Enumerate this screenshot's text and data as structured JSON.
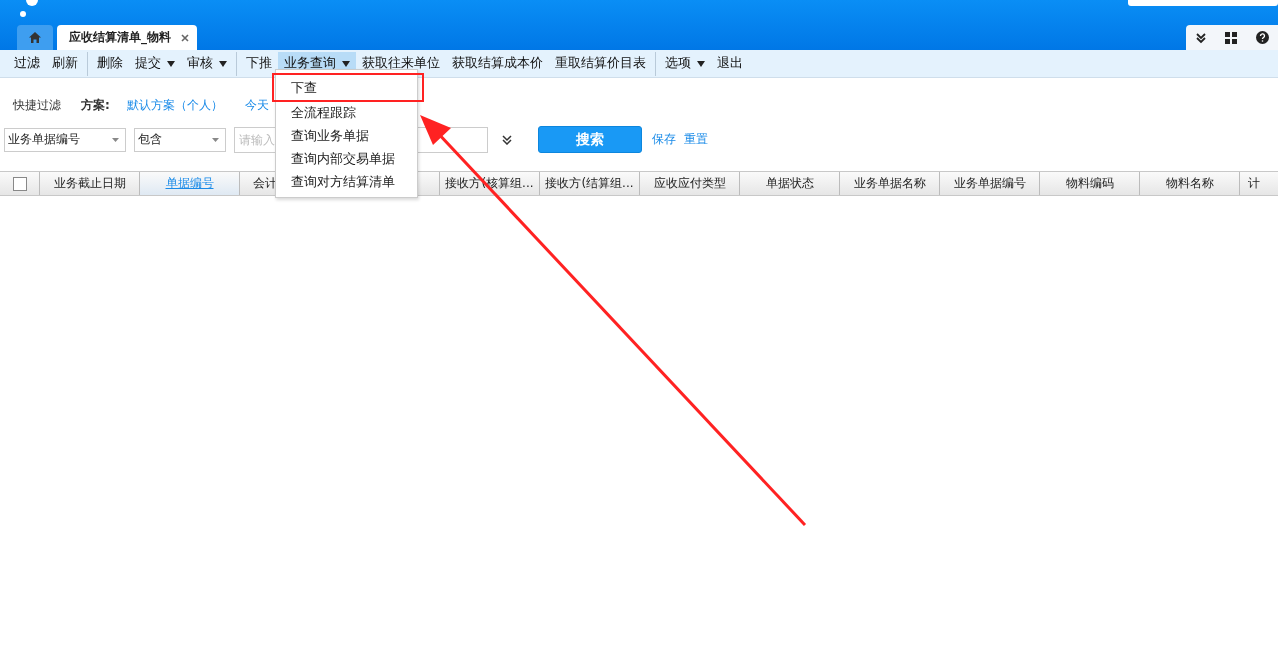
{
  "tabs": [
    {
      "label": "应收结算清单_物料",
      "selected": true,
      "closable": true
    }
  ],
  "toolbar": [
    {
      "label": "过滤",
      "dropdown": false,
      "active": false,
      "sep_before": false
    },
    {
      "label": "刷新",
      "dropdown": false,
      "active": false,
      "sep_before": false
    },
    {
      "label": "删除",
      "dropdown": false,
      "active": false,
      "sep_before": true
    },
    {
      "label": "提交",
      "dropdown": true,
      "active": false,
      "sep_before": false
    },
    {
      "label": "审核",
      "dropdown": true,
      "active": false,
      "sep_before": false
    },
    {
      "label": "下推",
      "dropdown": false,
      "active": false,
      "sep_before": true
    },
    {
      "label": "业务查询",
      "dropdown": true,
      "active": true,
      "sep_before": false
    },
    {
      "label": "获取往来单位",
      "dropdown": false,
      "active": false,
      "sep_before": false
    },
    {
      "label": "获取结算成本价",
      "dropdown": false,
      "active": false,
      "sep_before": false
    },
    {
      "label": "重取结算价目表",
      "dropdown": false,
      "active": false,
      "sep_before": false
    },
    {
      "label": "选项",
      "dropdown": true,
      "active": false,
      "sep_before": true
    },
    {
      "label": "退出",
      "dropdown": false,
      "active": false,
      "sep_before": false
    }
  ],
  "dropdown_menu": [
    {
      "label": "下查",
      "highlighted": true
    },
    {
      "label": "全流程跟踪",
      "highlighted": false
    },
    {
      "label": "查询业务单据",
      "highlighted": false
    },
    {
      "label": "查询内部交易单据",
      "highlighted": false
    },
    {
      "label": "查询对方结算清单",
      "highlighted": false
    }
  ],
  "filter": {
    "quick_filter": "快捷过滤",
    "scheme_label": "方案:",
    "schemes": [
      {
        "label": "默认方案（个人）"
      },
      {
        "label": "今天"
      }
    ],
    "field": "业务单据编号",
    "operator": "包含",
    "placeholder": "请输入",
    "search_button": "搜索",
    "save": "保存",
    "reset": "重置"
  },
  "table": {
    "select_all_checked": false,
    "columns": [
      {
        "label": "业务截止日期",
        "link": false
      },
      {
        "label": "单据编号",
        "link": true
      },
      {
        "label": "会计",
        "link": false
      },
      {
        "link": false
      },
      {
        "label": "接收方(核算组...",
        "link": false
      },
      {
        "label": "接收方(结算组...",
        "link": false
      },
      {
        "label": "应收应付类型",
        "link": false
      },
      {
        "label": "单据状态",
        "link": false
      },
      {
        "label": "业务单据名称",
        "link": false
      },
      {
        "label": "业务单据编号",
        "link": false
      },
      {
        "label": "物料编码",
        "link": false
      },
      {
        "label": "物料名称",
        "link": false
      },
      {
        "label": "计",
        "link": false
      }
    ]
  }
}
